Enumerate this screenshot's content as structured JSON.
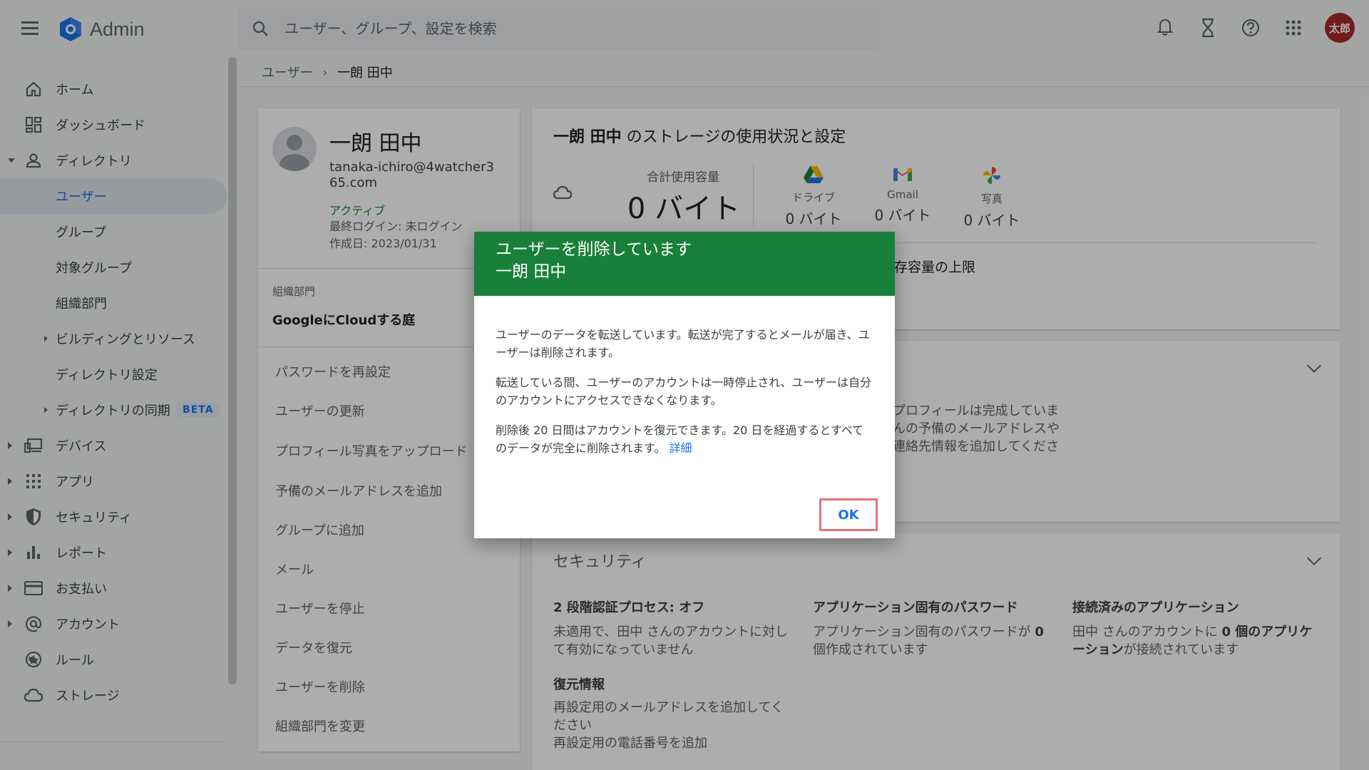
{
  "app": {
    "title": "Admin",
    "avatar_text": "太郎"
  },
  "search": {
    "placeholder": "ユーザー、グループ、設定を検索"
  },
  "sidebar": {
    "items": [
      {
        "label": "ホーム"
      },
      {
        "label": "ダッシュボード"
      },
      {
        "label": "ディレクトリ"
      },
      {
        "label": "ユーザー"
      },
      {
        "label": "グループ"
      },
      {
        "label": "対象グループ"
      },
      {
        "label": "組織部門"
      },
      {
        "label": "ビルディングとリソース"
      },
      {
        "label": "ディレクトリ設定"
      },
      {
        "label": "ディレクトリの同期",
        "badge": "BETA"
      },
      {
        "label": "デバイス"
      },
      {
        "label": "アプリ"
      },
      {
        "label": "セキュリティ"
      },
      {
        "label": "レポート"
      },
      {
        "label": "お支払い"
      },
      {
        "label": "アカウント"
      },
      {
        "label": "ルール"
      },
      {
        "label": "ストレージ"
      }
    ]
  },
  "breadcrumb": {
    "parent": "ユーザー",
    "separator": "›",
    "current": "一朗 田中"
  },
  "user": {
    "name": "一朗 田中",
    "email": "tanaka-ichiro@4watcher365.com",
    "status": "アクティブ",
    "last_login": "最終ログイン: 未ログイン",
    "created": "作成日: 2023/01/31",
    "org_label": "組織部門",
    "org_value": "GoogleにCloudする庭"
  },
  "actions": [
    "パスワードを再設定",
    "ユーザーの更新",
    "プロフィール写真をアップロード",
    "予備のメールアドレスを追加",
    "グループに追加",
    "メール",
    "ユーザーを停止",
    "データを復元",
    "ユーザーを削除",
    "組織部門を変更"
  ],
  "storage": {
    "title_name": "一朗 田中",
    "title_suffix": " のストレージの使用状況と設定",
    "total_label": "合計使用容量",
    "total_value": "0 バイト",
    "services": [
      {
        "label": "ドライブ",
        "value": "0 バイト",
        "icon": "drive-icon"
      },
      {
        "label": "Gmail",
        "value": "0 バイト",
        "icon": "gmail-icon"
      },
      {
        "label": "写真",
        "value": "0 バイト",
        "icon": "photos-icon"
      }
    ],
    "limit_partial": "存容量の上限"
  },
  "profile": {
    "partial_text": "プロフィールは完成していま\nんの予備のメールアドレスや\n連絡先情報を追加してくださ"
  },
  "security": {
    "title": "セキュリティ",
    "two_step_head": "2 段階認証プロセス: オフ",
    "two_step_body": "未適用で、田中 さんのアカウントに対して有効になっていません",
    "app_pw_head": "アプリケーション固有のパスワード",
    "app_pw_body_pre": "アプリケーション固有のパスワードが ",
    "app_pw_body_bold": "0",
    "app_pw_body_post": " 個作成されています",
    "connected_head": "接続済みのアプリケーション",
    "connected_body_pre": "田中 さんのアカウントに ",
    "connected_body_bold": "0 個のアプリケーション",
    "connected_body_post": "が接続されています",
    "recovery_head": "復元情報",
    "recovery_email": "再設定用のメールアドレスを追加してください",
    "recovery_phone": "再設定用の電話番号を追加"
  },
  "dialog": {
    "title": "ユーザーを削除しています",
    "subtitle": "一朗 田中",
    "p1": "ユーザーのデータを転送しています。転送が完了するとメールが届き、ユーザーは削除されます。",
    "p2": "転送している間、ユーザーのアカウントは一時停止され、ユーザーは自分のアカウントにアクセスできなくなります。",
    "p3": "削除後 20 日間はアカウントを復元できます。20 日を経過するとすべてのデータが完全に削除されます。",
    "link": "詳細",
    "ok": "OK"
  },
  "colors": {
    "header_green": "#188038",
    "link_blue": "#1a73e8",
    "avatar_red": "#a52a2a",
    "highlight": "#e57373"
  }
}
